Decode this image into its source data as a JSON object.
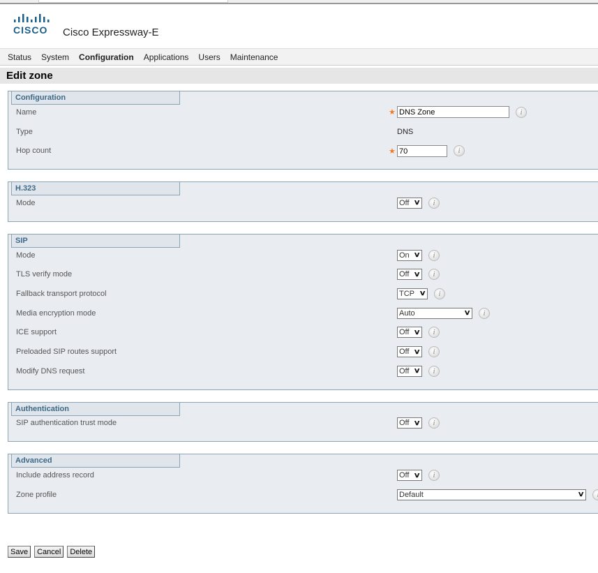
{
  "app": {
    "logo_text": "CISCO",
    "product": "Cisco Expressway-E"
  },
  "nav": [
    {
      "label": "Status",
      "active": false
    },
    {
      "label": "System",
      "active": false
    },
    {
      "label": "Configuration",
      "active": true
    },
    {
      "label": "Applications",
      "active": false
    },
    {
      "label": "Users",
      "active": false
    },
    {
      "label": "Maintenance",
      "active": false
    }
  ],
  "page": {
    "title": "Edit zone"
  },
  "colors": {
    "legend_text": "#3d6a8a",
    "required_star": "#f47a20",
    "section_bg": "#e9edf2"
  },
  "sections": [
    {
      "title": "Configuration",
      "fields": [
        {
          "label": "Name",
          "type": "text",
          "value": "DNS Zone",
          "required": true,
          "w": 161
        },
        {
          "label": "Type",
          "type": "static",
          "value": "DNS",
          "required": false
        },
        {
          "label": "Hop count",
          "type": "text",
          "value": "70",
          "required": true,
          "w": 72
        }
      ]
    },
    {
      "title": "H.323",
      "fields": [
        {
          "label": "Mode",
          "type": "select",
          "value": "Off",
          "w": 36
        }
      ]
    },
    {
      "title": "SIP",
      "fields": [
        {
          "label": "Mode",
          "type": "select",
          "value": "On",
          "w": 36
        },
        {
          "label": "TLS verify mode",
          "type": "select",
          "value": "Off",
          "w": 36
        },
        {
          "label": "Fallback transport protocol",
          "type": "select",
          "value": "TCP",
          "w": 44
        },
        {
          "label": "Media encryption mode",
          "type": "select",
          "value": "Auto",
          "w": 108
        },
        {
          "label": "ICE support",
          "type": "select",
          "value": "Off",
          "w": 36
        },
        {
          "label": "Preloaded SIP routes support",
          "type": "select",
          "value": "Off",
          "w": 36
        },
        {
          "label": "Modify DNS request",
          "type": "select",
          "value": "Off",
          "w": 36
        }
      ]
    },
    {
      "title": "Authentication",
      "fields": [
        {
          "label": "SIP authentication trust mode",
          "type": "select",
          "value": "Off",
          "w": 36
        }
      ]
    },
    {
      "title": "Advanced",
      "fields": [
        {
          "label": "Include address record",
          "type": "select",
          "value": "Off",
          "w": 36
        },
        {
          "label": "Zone profile",
          "type": "select",
          "value": "Default",
          "w": 271
        }
      ]
    }
  ],
  "buttons": {
    "save": "Save",
    "cancel": "Cancel",
    "delete": "Delete"
  }
}
